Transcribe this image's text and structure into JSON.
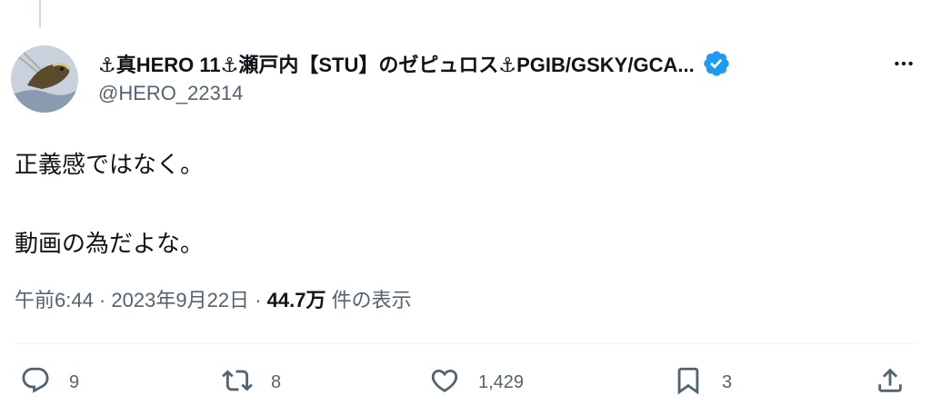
{
  "tweet": {
    "display_name": "⚓真HERO 11⚓瀬戸内【STU】のゼピュロス⚓PGIB/GSKY/GCA...",
    "handle": "@HERO_22314",
    "text_line1": "正義感ではなく。",
    "text_line2": "動画の為だよな。",
    "time": "午前6:44",
    "separator": "·",
    "date": "2023年9月22日",
    "views_count": "44.7万",
    "views_label": "件の表示",
    "verified_badge": "verified-check-icon",
    "more_icon": "more-horizontal-icon"
  },
  "actions": {
    "replies": "9",
    "reposts": "8",
    "likes": "1,429",
    "bookmarks": "3"
  },
  "colors": {
    "text": "#0f1419",
    "secondary": "#536471",
    "verified": "#1d9bf0",
    "divider": "#eff3f4"
  }
}
